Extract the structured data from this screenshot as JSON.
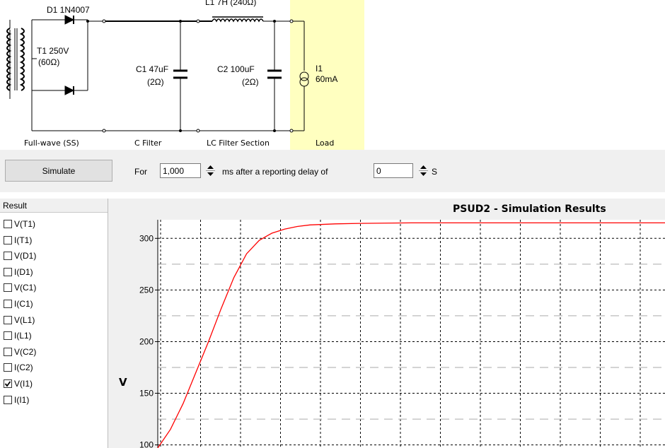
{
  "schematic": {
    "d1_label": "D1 1N4007",
    "l1_label": "L1 7H (240Ω)",
    "t1_label1": "T1 250V",
    "t1_label2": "(60Ω)",
    "c1_label1": "C1 47uF",
    "c1_label2": "(2Ω)",
    "c2_label1": "C2 100uF",
    "c2_label2": "(2Ω)",
    "i1_label1": "I1",
    "i1_label2": "60mA",
    "sections": [
      "Full-wave (SS)",
      "C Filter",
      "LC Filter Section",
      "Load"
    ],
    "load_bg_color": "#ffffc0"
  },
  "toolbar": {
    "simulate_label": "Simulate",
    "for_label": "For",
    "duration_value": "1,000",
    "ms_label": "ms  after a reporting delay of",
    "delay_value": "0",
    "s_label": "S"
  },
  "results": {
    "header": "Result",
    "items": [
      {
        "label": "V(T1)",
        "checked": false
      },
      {
        "label": "I(T1)",
        "checked": false
      },
      {
        "label": "V(D1)",
        "checked": false
      },
      {
        "label": "I(D1)",
        "checked": false
      },
      {
        "label": "V(C1)",
        "checked": false
      },
      {
        "label": "I(C1)",
        "checked": false
      },
      {
        "label": "V(L1)",
        "checked": false
      },
      {
        "label": "I(L1)",
        "checked": false
      },
      {
        "label": "V(C2)",
        "checked": false
      },
      {
        "label": "I(C2)",
        "checked": false
      },
      {
        "label": "V(I1)",
        "checked": true
      },
      {
        "label": "I(I1)",
        "checked": false
      }
    ]
  },
  "chart_data": {
    "type": "line",
    "title": "PSUD2 - Simulation Results",
    "ylabel": "V",
    "xlabel": "",
    "yticks": [
      100,
      150,
      200,
      250,
      300
    ],
    "ylim_visible": [
      97,
      318
    ],
    "grid": true,
    "line_color": "#ff0000",
    "series": [
      {
        "points": [
          [
            0,
            97
          ],
          [
            0.5,
            115
          ],
          [
            1,
            140
          ],
          [
            1.5,
            170
          ],
          [
            2,
            200
          ],
          [
            2.5,
            232
          ],
          [
            3,
            262
          ],
          [
            3.5,
            285
          ],
          [
            4,
            298
          ],
          [
            4.5,
            305
          ],
          [
            5,
            309
          ],
          [
            5.5,
            311.5
          ],
          [
            6,
            313
          ],
          [
            7,
            314
          ],
          [
            8,
            314.5
          ],
          [
            10,
            315
          ],
          [
            14,
            315
          ],
          [
            20,
            315
          ]
        ]
      }
    ]
  }
}
